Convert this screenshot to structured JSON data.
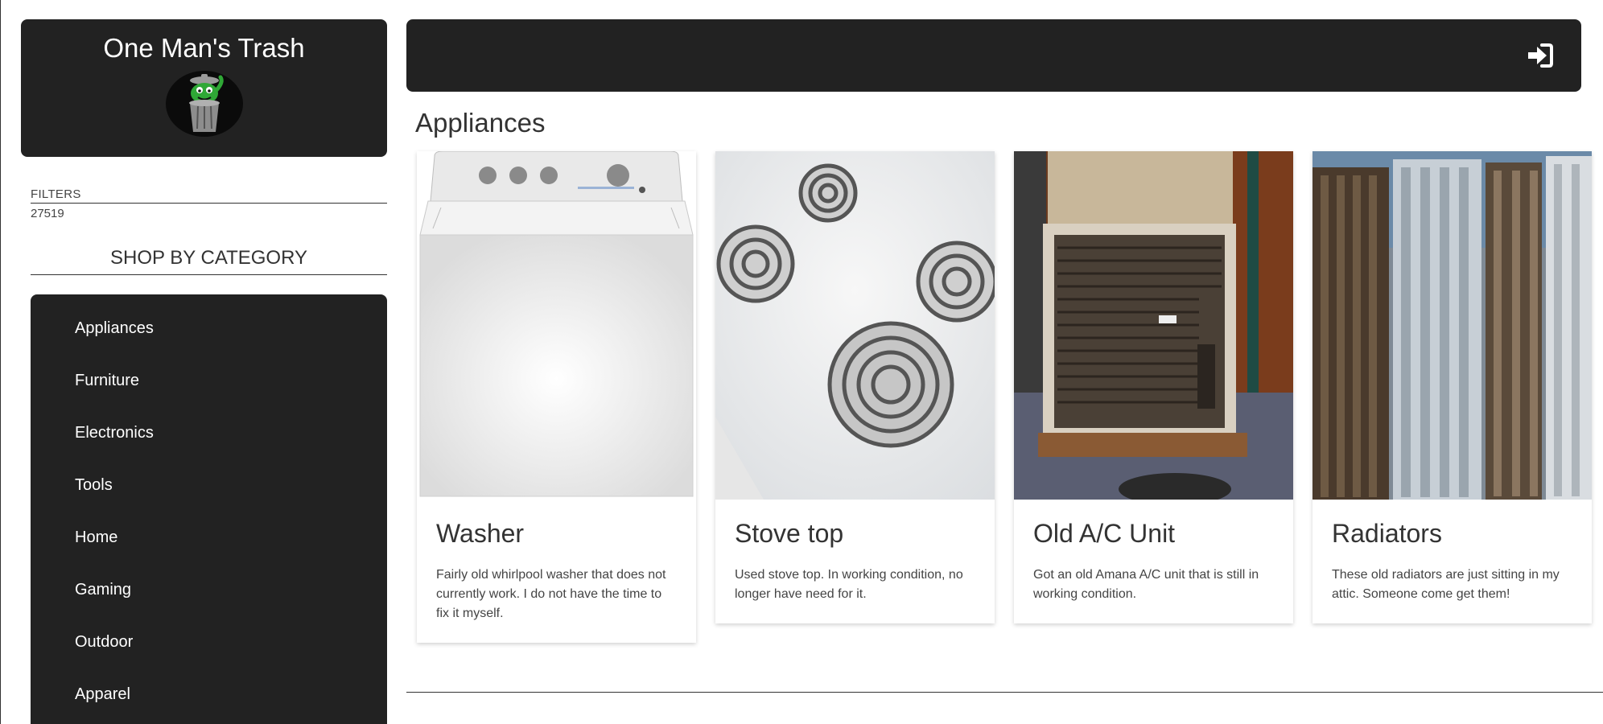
{
  "brand": {
    "title": "One Man's Trash",
    "logo_icon": "trash-can-monster-icon"
  },
  "filters": {
    "label": "FILTERS",
    "zip": "27519"
  },
  "sidebar": {
    "heading": "SHOP BY CATEGORY",
    "categories": [
      {
        "label": "Appliances"
      },
      {
        "label": "Furniture"
      },
      {
        "label": "Electronics"
      },
      {
        "label": "Tools"
      },
      {
        "label": "Home"
      },
      {
        "label": "Gaming"
      },
      {
        "label": "Outdoor"
      },
      {
        "label": "Apparel"
      }
    ]
  },
  "topbar": {
    "login_icon": "sign-in-icon"
  },
  "main": {
    "section_title": "Appliances",
    "listings": [
      {
        "title": "Washer",
        "description": "Fairly old whirlpool washer that does not currently work. I do not have the time to fix it myself.",
        "image_icon": "washer-photo"
      },
      {
        "title": "Stove top",
        "description": "Used stove top. In working condition, no longer have need for it.",
        "image_icon": "stove-top-photo"
      },
      {
        "title": "Old A/C Unit",
        "description": "Got an old Amana A/C unit that is still in working condition.",
        "image_icon": "ac-unit-photo"
      },
      {
        "title": "Radiators",
        "description": "These old radiators are just sitting in my attic. Someone come get them!",
        "image_icon": "radiators-photo"
      }
    ]
  },
  "colors": {
    "panel_dark": "#222222",
    "text_dark": "#333333",
    "logo_green": "#2fa836"
  }
}
